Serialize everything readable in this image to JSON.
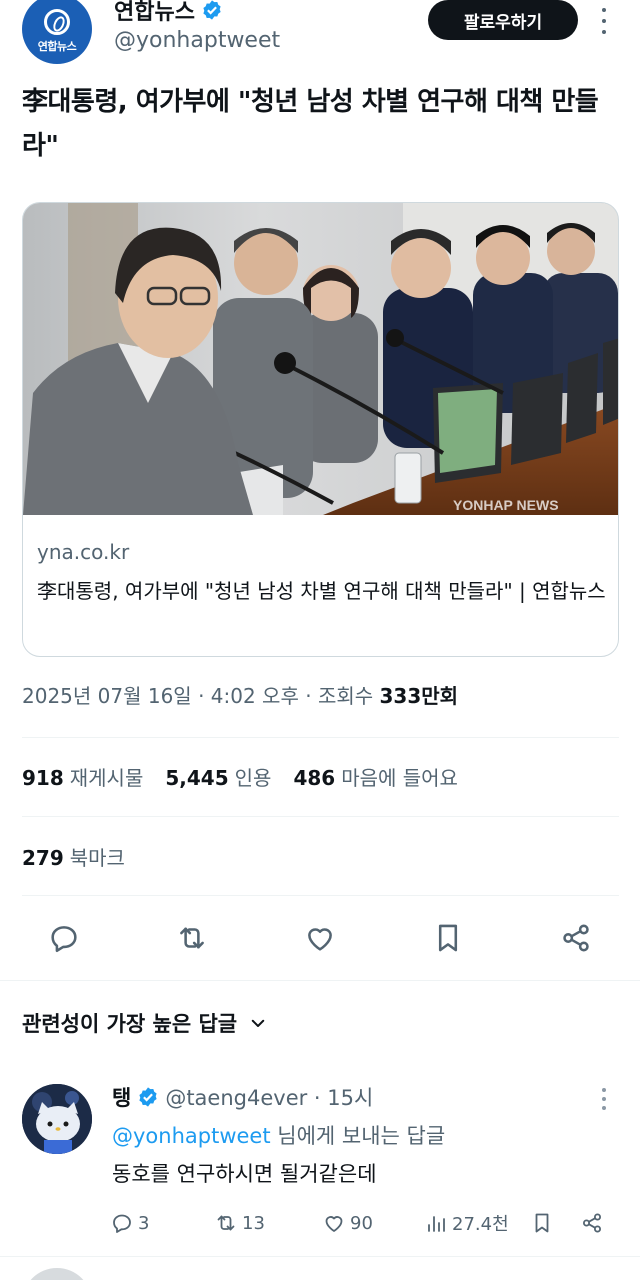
{
  "author": {
    "name": "연합뉴스",
    "handle": "@yonhaptweet",
    "avatar_text": "연합뉴스",
    "follow_label": "팔로우하기",
    "brand_color": "#1b5fb5",
    "verified_color": "#1d9bf0"
  },
  "tweet": {
    "text": "李대통령, 여가부에 \"청년 남성 차별 연구해 대책 만들라\""
  },
  "card": {
    "domain": "yna.co.kr",
    "title": "李대통령, 여가부에 \"청년 남성 차별 연구해 대책 만들라\" | 연합뉴스",
    "watermark": "YONHAP NEWS"
  },
  "meta": {
    "date_time": "2025년 07월 16일 · 4:02 오후 · ",
    "views_label": "조회수 ",
    "views_value": "333만회"
  },
  "stats": {
    "retweets_value": "918",
    "retweets_label": "재게시물",
    "quotes_value": "5,445",
    "quotes_label": "인용",
    "likes_value": "486",
    "likes_label": "마음에 들어요",
    "bookmarks_value": "279",
    "bookmarks_label": "북마크"
  },
  "actions": {
    "icons": [
      "reply-icon",
      "retweet-icon",
      "like-icon",
      "bookmark-icon",
      "share-icon"
    ]
  },
  "replies": {
    "sort_label": "관련성이 가장 높은 답글"
  },
  "reply": {
    "name": "탱",
    "handle": "@taeng4ever · 15시",
    "reply_to_mention": "@yonhaptweet",
    "reply_to_suffix": " 님에게 보내는 답글",
    "text": "동호를 연구하시면 될거같은데",
    "reply_count": "3",
    "retweet_count": "13",
    "like_count": "90",
    "view_count": "27.4천"
  }
}
